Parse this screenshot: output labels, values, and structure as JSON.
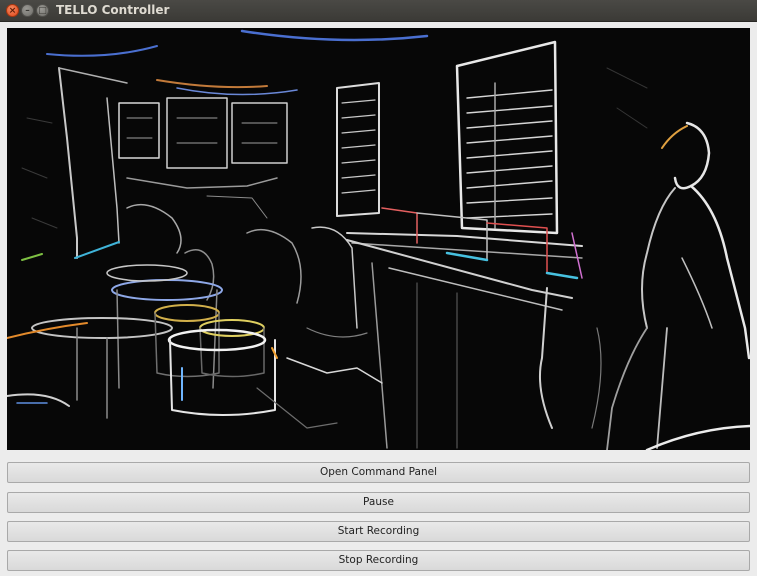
{
  "window": {
    "title": "TELLO Controller",
    "controls": {
      "close": "×",
      "minimize": "–",
      "maximize": "□"
    }
  },
  "video": {
    "icon": "video-feed",
    "description_icon": "edge-detected camera frame"
  },
  "buttons": {
    "open_command_panel": "Open Command Panel",
    "pause": "Pause",
    "start_recording": "Start Recording",
    "stop_recording": "Stop Recording"
  },
  "colors": {
    "titlebar": "#3b3a36",
    "window_bg": "#ececec",
    "close_button": "#e0461a",
    "video_bg": "#070707"
  }
}
